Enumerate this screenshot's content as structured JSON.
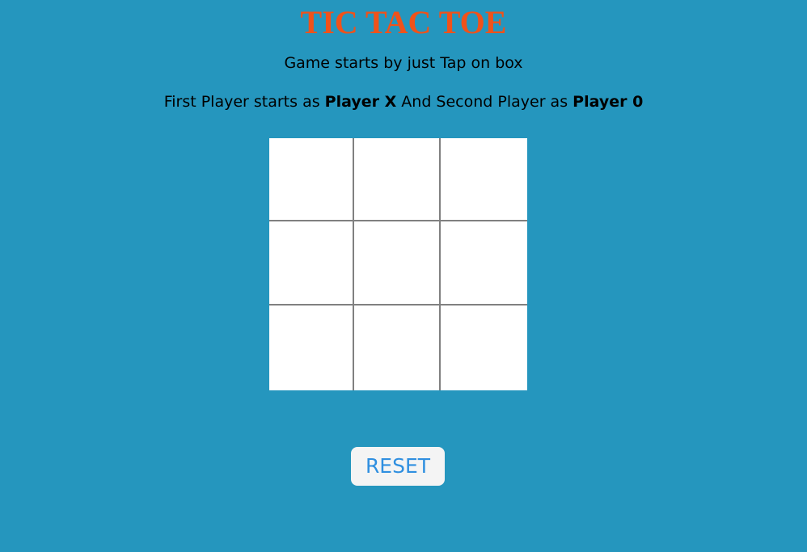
{
  "header": {
    "title": "TIC TAC TOE",
    "subtitle": "Game starts by just Tap on box",
    "instructions": {
      "prefix": "First Player starts as ",
      "player_one": "Player X",
      "middle": " And Second Player as ",
      "player_two": "Player 0"
    }
  },
  "board": {
    "cells": [
      "",
      "",
      "",
      "",
      "",
      "",
      "",
      "",
      ""
    ]
  },
  "controls": {
    "reset_label": "RESET"
  },
  "colors": {
    "background": "#2596be",
    "title": "#f0521a",
    "board": "#ffffff",
    "grid_lines": "#808080",
    "reset_text": "#2f8fe0",
    "reset_bg": "#f4f4f4"
  }
}
